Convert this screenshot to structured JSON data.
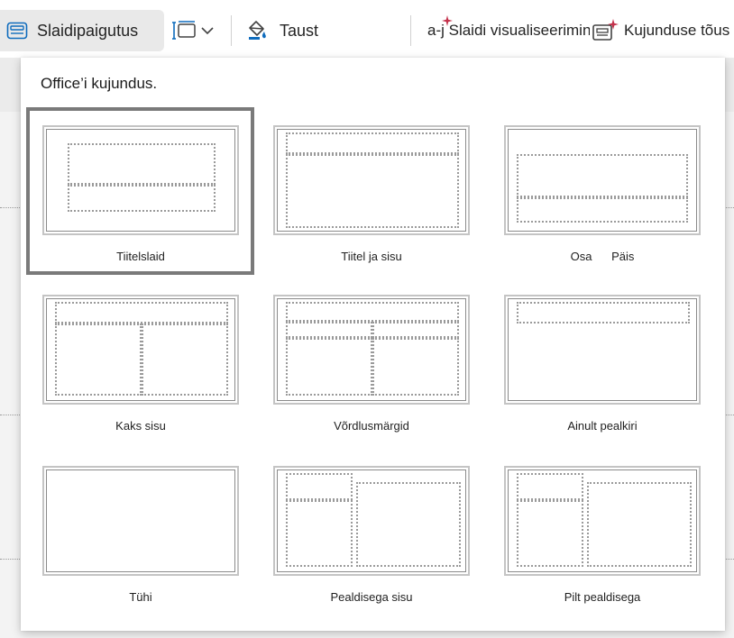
{
  "ribbon": {
    "slide_layout_label": "Slaidipaigutus",
    "background_label": "Taust",
    "visualize_label": "a-j Slaidi visualiseerimine",
    "designer_label": "Kujunduse tõus"
  },
  "panel": {
    "header": "Office’i kujundus.",
    "layouts": [
      {
        "name": "Tiitelslaid",
        "selected": true
      },
      {
        "name": "Tiitel ja sisu",
        "selected": false
      },
      {
        "name": "Osa      Päis",
        "selected": false
      },
      {
        "name": "Kaks sisu",
        "selected": false
      },
      {
        "name": "Võrdlusmärgid",
        "selected": false
      },
      {
        "name": "Ainult pealkiri",
        "selected": false
      },
      {
        "name": "Tühi",
        "selected": false
      },
      {
        "name": "Pealdisega sisu",
        "selected": false
      },
      {
        "name": "Pilt pealdisega",
        "selected": false
      }
    ]
  },
  "icons": {
    "slide_layout": "slide-layout-icon",
    "slide_size": "slide-size-icon",
    "background": "paint-bucket-icon",
    "visualize": "sparkle-text-icon",
    "designer": "designer-sparkle-icon"
  },
  "colors": {
    "accent": "#0f6cbd",
    "selection_border": "#7a7a7a",
    "sparkle": "#c4314b"
  }
}
